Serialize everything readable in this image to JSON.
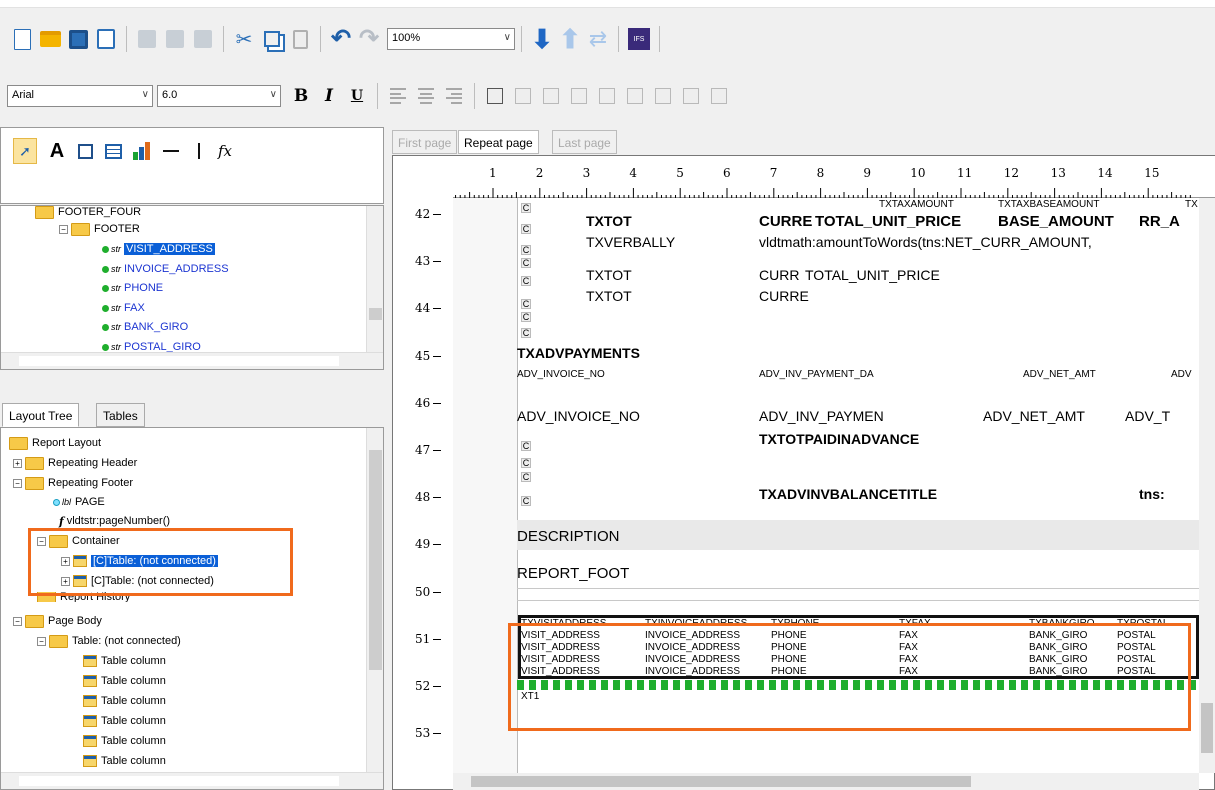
{
  "toolbar": {
    "zoom": "100%",
    "ifs_logo": "IFS",
    "font_name": "Arial",
    "font_size": "6.0",
    "bold": "B",
    "italic": "I",
    "underline": "U"
  },
  "palette": {
    "text_tool": "A",
    "function_tool": "fx"
  },
  "fields_tree": {
    "items": [
      {
        "label": "FOOTER_FOUR"
      },
      {
        "label": "FOOTER"
      },
      {
        "label": "VISIT_ADDRESS"
      },
      {
        "label": "INVOICE_ADDRESS"
      },
      {
        "label": "PHONE"
      },
      {
        "label": "FAX"
      },
      {
        "label": "BANK_GIRO"
      },
      {
        "label": "POSTAL_GIRO"
      }
    ],
    "str": "str"
  },
  "left_tabs": {
    "layout_tree": "Layout Tree",
    "tables": "Tables"
  },
  "layout_tree": {
    "report_layout": "Report Layout",
    "repeating_header": "Repeating Header",
    "repeating_footer": "Repeating Footer",
    "page": "PAGE",
    "lbl": "lbl",
    "page_number": "vldtstr:pageNumber()",
    "container": "Container",
    "table1": "[C]Table: (not connected)",
    "table2": "[C]Table: (not connected)",
    "report_history": "Report History",
    "page_body": "Page Body",
    "body_table": "Table: (not connected)",
    "table_column": "Table column"
  },
  "page_tabs": {
    "first": "First page",
    "repeat": "Repeat page",
    "last": "Last page"
  },
  "ruler": {
    "h": [
      "1",
      "2",
      "3",
      "4",
      "5",
      "6",
      "7",
      "8",
      "9",
      "10",
      "11",
      "12",
      "13",
      "14",
      "15"
    ],
    "v": [
      "42",
      "43",
      "44",
      "45",
      "46",
      "47",
      "48",
      "49",
      "50",
      "51",
      "52",
      "53"
    ]
  },
  "canvas": {
    "c": "C",
    "txtaxamount": "TXTAXAMOUNT",
    "txtaxbaseamount": "TXTAXBASEAMOUNT",
    "tx": "TX",
    "txtot": "TXTOT",
    "curre": "CURRE",
    "total_unit_price": "TOTAL_UNIT_PRICE",
    "base_amount": "BASE_AMOUNT",
    "rr_a": "RR_A",
    "txverbally": "TXVERBALLY",
    "amount_words": "vldtmath:amountToWords(tns:NET_CURR_AMOUNT,",
    "curr": "CURR",
    "total_unit_price2": "TOTAL_UNIT_PRICE",
    "txtot3": "TXTOT",
    "curre3": "CURRE",
    "txadvpayments": "TXADVPAYMENTS",
    "adv_invoice_no_s": "ADV_INVOICE_NO",
    "adv_inv_payment_da": "ADV_INV_PAYMENT_DA",
    "adv_net_amt_s": "ADV_NET_AMT",
    "adv_s": "ADV",
    "adv_invoice_no": "ADV_INVOICE_NO",
    "adv_inv_paymen": "ADV_INV_PAYMEN",
    "adv_net_amt": "ADV_NET_AMT",
    "adv_t": "ADV_T",
    "txtotpaidinadvance": "TXTOTPAIDINADVANCE",
    "txadvinvbalancetitle": "TXADVINVBALANCETITLE",
    "tns": "tns:",
    "description": "DESCRIPTION",
    "report_foot": "REPORT_FOOT",
    "footer_headers": [
      "TXVISITADDRESS",
      "TXINVOICEADDRESS",
      "TXPHONE",
      "TXFAX",
      "TXBANKGIRO",
      "TXPOSTAL"
    ],
    "footer_values": [
      "VISIT_ADDRESS",
      "INVOICE_ADDRESS",
      "PHONE",
      "FAX",
      "BANK_GIRO",
      "POSTAL"
    ],
    "xt1": "XT1"
  },
  "colors": {
    "highlight": "#f06a1c",
    "selection": "#0a5fd7",
    "field_blue": "#1c35d1"
  }
}
